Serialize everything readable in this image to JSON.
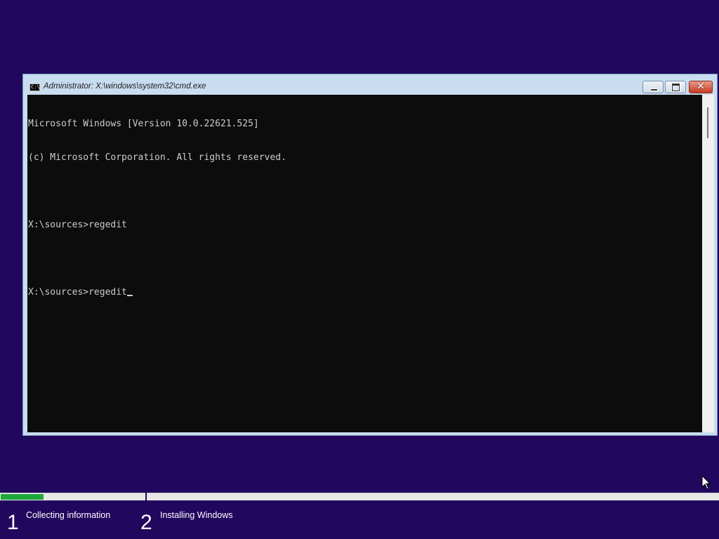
{
  "window": {
    "title": "Administrator: X:\\windows\\system32\\cmd.exe",
    "icon": "cmd-icon",
    "icon_text": "C:\\",
    "close_glyph": "✕"
  },
  "console": {
    "lines": [
      "Microsoft Windows [Version 10.0.22621.525]",
      "(c) Microsoft Corporation. All rights reserved.",
      "",
      "X:\\sources>regedit",
      "",
      "X:\\sources>regedit"
    ]
  },
  "setup": {
    "progress_fraction": 0.06,
    "steps": [
      {
        "number": "1",
        "label": "Collecting information"
      },
      {
        "number": "2",
        "label": "Installing Windows"
      }
    ]
  },
  "colors": {
    "background": "#22075e",
    "progress": "#1ea83c",
    "console_bg": "#0c0c0c",
    "console_text": "#cccccc"
  }
}
